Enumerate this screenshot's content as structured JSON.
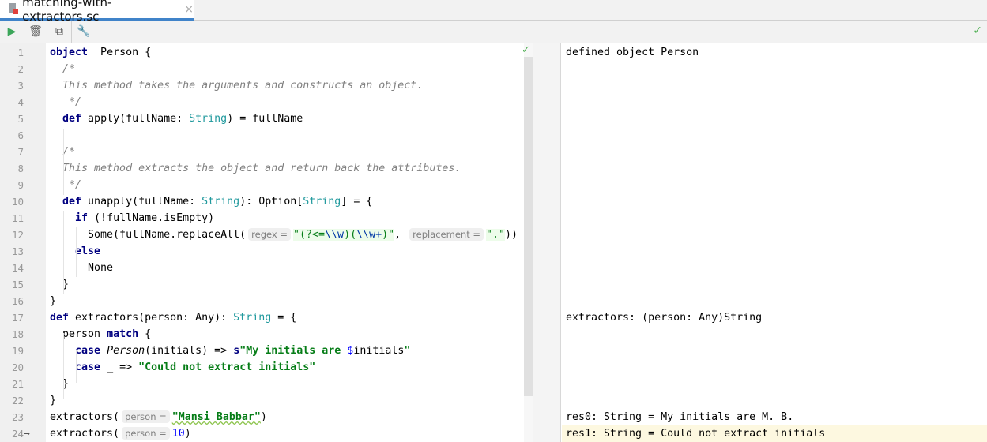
{
  "tab": {
    "title": "matching-with-extractors.sc",
    "close": "×"
  },
  "toolbar": {
    "run": "▶",
    "clear": "🗑",
    "copy": "⧉",
    "settings": "🔧",
    "status": "✓"
  },
  "editor": {
    "status": "✓",
    "current_line_marker": "→",
    "lines": [
      {
        "n": "1",
        "t": [
          [
            "k",
            "object"
          ],
          [
            "",
            "  Person {"
          ]
        ]
      },
      {
        "n": "2",
        "t": [
          [
            "c",
            "  /*"
          ]
        ]
      },
      {
        "n": "3",
        "t": [
          [
            "c",
            "  This method takes the arguments and constructs an object."
          ]
        ]
      },
      {
        "n": "4",
        "t": [
          [
            "c",
            "   */"
          ]
        ]
      },
      {
        "n": "5",
        "t": [
          [
            "",
            "  "
          ],
          [
            "k",
            "def"
          ],
          [
            "",
            " apply(fullName: "
          ],
          [
            "t",
            "String"
          ],
          [
            "",
            ") = fullName"
          ]
        ]
      },
      {
        "n": "6",
        "t": []
      },
      {
        "n": "7",
        "t": [
          [
            "c",
            "  /*"
          ]
        ]
      },
      {
        "n": "8",
        "t": [
          [
            "c",
            "  This method extracts the object and return back the attributes."
          ]
        ]
      },
      {
        "n": "9",
        "t": [
          [
            "c",
            "   */"
          ]
        ]
      },
      {
        "n": "10",
        "t": [
          [
            "",
            "  "
          ],
          [
            "k",
            "def"
          ],
          [
            "",
            " unapply(fullName: "
          ],
          [
            "t",
            "String"
          ],
          [
            "",
            "): Option["
          ],
          [
            "t",
            "String"
          ],
          [
            "",
            "] = {"
          ]
        ]
      },
      {
        "n": "11",
        "t": [
          [
            "",
            "    "
          ],
          [
            "k",
            "if"
          ],
          [
            "",
            " (!fullName.isEmpty)"
          ]
        ]
      },
      {
        "n": "12",
        "t": [
          [
            "",
            "      Some(fullName.replaceAll("
          ],
          [
            "h",
            "regex ="
          ],
          [
            "sr",
            "\"(?<="
          ],
          [
            "e",
            "\\\\w"
          ],
          [
            "sr",
            ")("
          ],
          [
            "e",
            "\\\\w+"
          ],
          [
            "sr",
            ")\""
          ],
          [
            "",
            ", "
          ],
          [
            "h",
            "replacement ="
          ],
          [
            "sr",
            "\".\""
          ],
          [
            "",
            "))"
          ]
        ]
      },
      {
        "n": "13",
        "t": [
          [
            "",
            "    "
          ],
          [
            "k",
            "else"
          ]
        ]
      },
      {
        "n": "14",
        "t": [
          [
            "",
            "      None"
          ]
        ]
      },
      {
        "n": "15",
        "t": [
          [
            "",
            "  }"
          ]
        ]
      },
      {
        "n": "16",
        "t": [
          [
            "",
            "}"
          ]
        ]
      },
      {
        "n": "17",
        "t": [
          [
            "k",
            "def"
          ],
          [
            "",
            " extractors(person: Any): "
          ],
          [
            "t",
            "String"
          ],
          [
            "",
            " = {"
          ]
        ]
      },
      {
        "n": "18",
        "t": [
          [
            "",
            "  person "
          ],
          [
            "k",
            "match"
          ],
          [
            "",
            " {"
          ]
        ]
      },
      {
        "n": "19",
        "t": [
          [
            "",
            "    "
          ],
          [
            "k",
            "case"
          ],
          [
            " i",
            " Person"
          ],
          [
            "",
            "(initials) => "
          ],
          [
            "k",
            "s"
          ],
          [
            "s",
            "\"My initials are "
          ],
          [
            "n",
            "$"
          ],
          [
            "",
            "initials"
          ],
          [
            "s",
            "\""
          ]
        ]
      },
      {
        "n": "20",
        "t": [
          [
            "",
            "    "
          ],
          [
            "k",
            "case"
          ],
          [
            "",
            " _ => "
          ],
          [
            "s",
            "\"Could not extract initials\""
          ]
        ]
      },
      {
        "n": "21",
        "t": [
          [
            "",
            "  }"
          ]
        ]
      },
      {
        "n": "22",
        "t": [
          [
            "",
            "}"
          ]
        ]
      },
      {
        "n": "23",
        "t": [
          [
            "",
            "extractors("
          ],
          [
            "h",
            "person ="
          ],
          [
            "s",
            "\"Mansi Babbar\""
          ],
          [
            "",
            ")"
          ]
        ]
      },
      {
        "n": "24",
        "t": [
          [
            "",
            "extractors("
          ],
          [
            "h",
            "person ="
          ],
          [
            "n",
            "10"
          ],
          [
            "",
            ")"
          ]
        ]
      }
    ]
  },
  "output": [
    {
      "line": 1,
      "text": "defined object Person"
    },
    {
      "line": 17,
      "text": "extractors: (person: Any)String"
    },
    {
      "line": 23,
      "text": "res0: String = My initials are M. B."
    },
    {
      "line": 24,
      "text": "res1: String = Could not extract initials"
    }
  ]
}
